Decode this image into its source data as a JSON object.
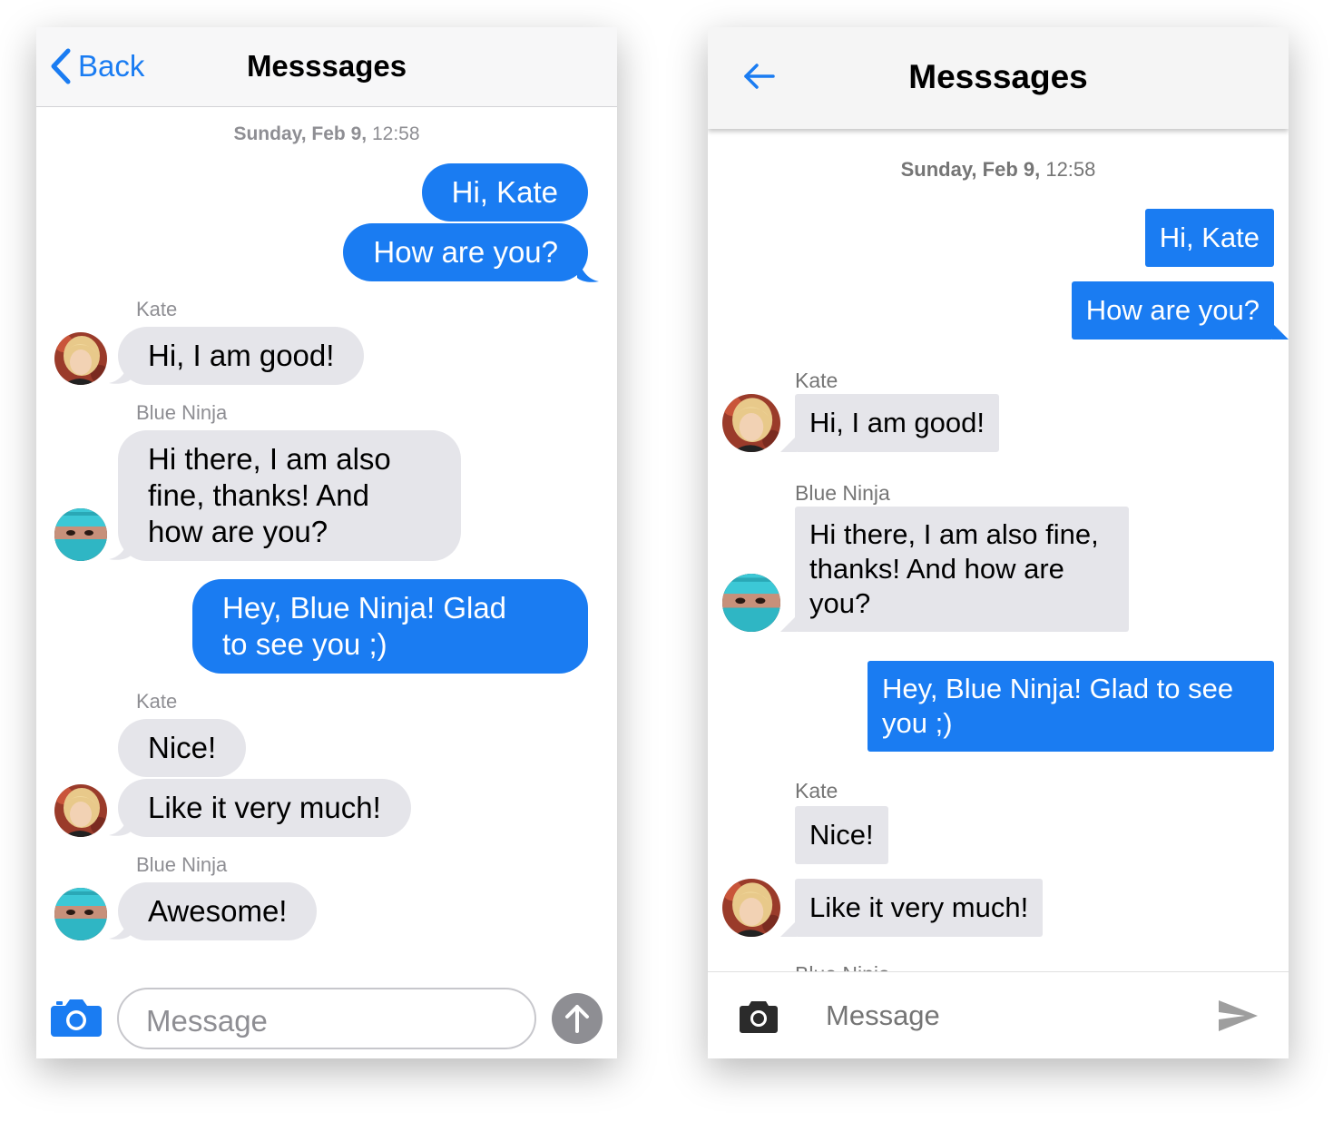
{
  "ios": {
    "back_label": "Back",
    "title": "Messsages",
    "date_day": "Sunday, Feb 9,",
    "date_time": " 12:58",
    "input_placeholder": "Message",
    "messages": [
      {
        "text": "Hi, Kate"
      },
      {
        "text": "How are you?"
      },
      {
        "sender": "Kate",
        "text": "Hi, I am good!"
      },
      {
        "sender": "Blue Ninja",
        "lines": [
          "Hi there, I am also",
          "fine, thanks! And",
          "how are you?"
        ]
      },
      {
        "lines": [
          "Hey, Blue Ninja! Glad",
          "to see you ;)"
        ]
      },
      {
        "sender": "Kate",
        "text": "Nice!"
      },
      {
        "text": "Like it very much!"
      },
      {
        "sender": "Blue Ninja",
        "text": "Awesome!"
      }
    ]
  },
  "material": {
    "title": "Messsages",
    "date_day": "Sunday, Feb 9,",
    "date_time": " 12:58",
    "input_placeholder": "Message",
    "messages": [
      {
        "text": "Hi, Kate"
      },
      {
        "text": "How are you?"
      },
      {
        "sender": "Kate",
        "text": "Hi, I am good!"
      },
      {
        "sender": "Blue Ninja",
        "lines": [
          "Hi there, I am also fine,",
          "thanks! And how are",
          "you?"
        ]
      },
      {
        "lines": [
          "Hey, Blue Ninja! Glad to see",
          "you ;)"
        ]
      },
      {
        "sender": "Kate",
        "text": "Nice!"
      },
      {
        "text": "Like it very much!"
      },
      {
        "sender": "Blue Ninja"
      }
    ]
  },
  "colors": {
    "accent": "#1a7cf2",
    "incoming_bubble": "#e5e5ea",
    "secondary_text": "#8e8e93"
  },
  "icons": [
    "chevron-left-icon",
    "camera-icon",
    "arrow-up-icon",
    "arrow-left-icon",
    "send-icon"
  ]
}
